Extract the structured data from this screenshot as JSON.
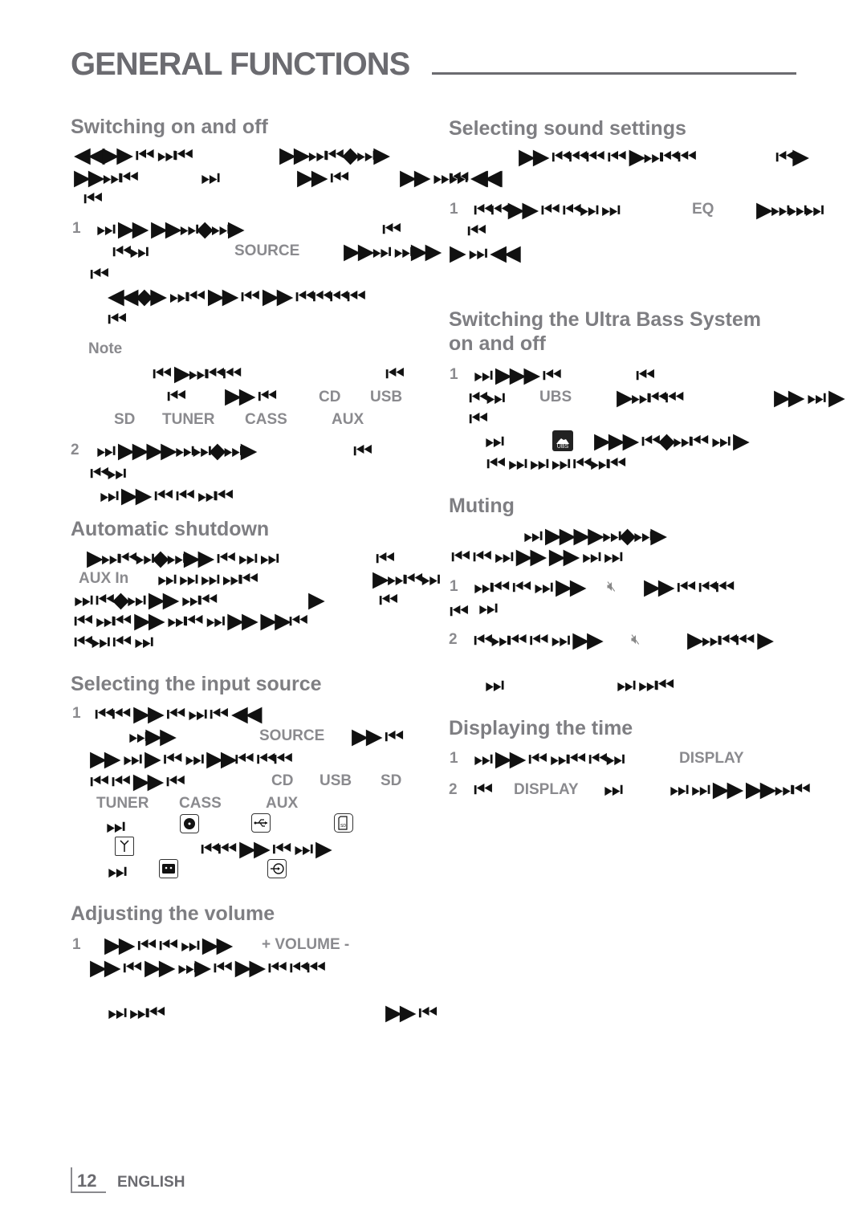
{
  "page": {
    "title": "GENERAL FUNCTIONS",
    "footer": {
      "page_number": "12",
      "language": "ENGLISH"
    }
  },
  "glyphs": {
    "a": "◀◀▶▶ ⏮ ⏭⏮",
    "b": "▶▶⏭⏮◆⏭▶",
    "c": "▶▶⏭⏮",
    "d": "⏭",
    "e": "▶▶ ⏮",
    "f": "▶▶ ⏭⏮ ◀◀",
    "g": "⏮",
    "h": "⏭ ▶▶ ▶▶⏭◆⏭▶",
    "i": "⏮⏭",
    "j": "▶▶⏭ ⏭▶▶",
    "k": "⏭ ◀◀",
    "l": "◀◀◆▶ ⏭⏮ ▶▶ ⏮ ▶▶ ⏮⏮⏮⏮",
    "m": "⏮ ▶⏭⏮⏮",
    "n": "▶▶ ⏮",
    "o": "⏭ ▶▶▶▶⏭⏭◆⏭▶",
    "p": "⏭ ▶▶ ⏮ ⏮ ⏭⏮",
    "q": "▶⏭⏮⏭◆⏭▶▶ ⏮ ⏭ ⏭",
    "r": "⏭ ⏭ ⏭ ⏭⏮",
    "s": "▶⏭⏮⏭",
    "t": "⏭ ⏮◆⏭ ▶▶ ⏭⏮",
    "u": "▶",
    "v": "⏮ ⏭⏮ ▶▶ ⏭⏮ ⏭ ▶▶ ▶▶⏮",
    "w": "⏮⏭ ⏮ ⏭",
    "x": "⏮⏮ ▶▶ ⏮ ⏭ ⏮ ◀◀",
    "y": "⏭▶▶",
    "z": "▶▶ ⏭ ▶ ⏮ ⏭ ▶▶⏮ ⏮⏮",
    "aa": "⏮ ⏮ ▶▶ ⏮",
    "ab": "⏮⏮ ▶▶ ⏮ ⏭ ▶",
    "ac": "▶▶ ⏮ ⏮ ⏭ ▶▶",
    "ad": "▶▶ ⏮ ▶▶ ⏭▶ ⏮ ▶▶ ⏮ ⏮⏮",
    "ae": "⏭ ⏭⏮",
    "af": "▶▶ ⏮⏮⏮ ⏮ ▶⏭⏮⏮",
    "ag": "⏮▶",
    "ah": "⏭ ◀◀",
    "ai": "⏮⏮▶▶ ⏮ ⏮⏭ ⏭",
    "aj": "▶⏭⏭⏭",
    "ak": "▶ ⏭ ◀◀",
    "al": "⏭ ▶▶▶ ⏮",
    "am": "⏮⏭",
    "an": "▶⏭⏮⏮",
    "ao": "▶▶ ⏭ ▶",
    "ap": "▶▶▶ ⏮◆⏭⏮ ⏭ ▶",
    "aq": "⏮ ⏭ ⏭ ⏭ ⏮⏭⏮",
    "ar": "⏭ ▶▶▶▶⏭◆⏭▶",
    "as": "⏮ ⏮ ⏭ ▶▶ ▶▶ ⏭ ⏭",
    "at": "⏭⏮ ⏮ ⏭ ▶▶",
    "au": "▶▶ ⏮ ⏮⏮",
    "av": "⏮⏭⏮ ⏮ ⏭ ▶▶",
    "aw": "▶⏭⏮⏮ ▶",
    "ax": "⏭ ⏭⏮",
    "ay": "⏭ ▶▶ ⏮ ⏭⏮ ⏮⏭",
    "az": "⏮",
    "ba": "⏭ ⏭ ▶▶ ▶▶⏭⏮"
  },
  "left_column": {
    "switching": {
      "heading": "Switching on and off",
      "step1": "1",
      "source_label": "SOURCE",
      "note_label": "Note",
      "sources": [
        "CD",
        "USB",
        "SD",
        "TUNER",
        "CASS",
        "AUX"
      ],
      "step2": "2"
    },
    "shutdown": {
      "heading": "Automatic shutdown",
      "aux_in_label": "AUX In"
    },
    "input_source": {
      "heading": "Selecting the input source",
      "step1": "1",
      "source_label": "SOURCE",
      "sources": [
        "CD",
        "USB",
        "SD",
        "TUNER",
        "CASS",
        "AUX"
      ],
      "icons": [
        "cd-icon",
        "usb-icon",
        "sd-card-icon",
        "tuner-antenna-icon",
        "cassette-icon",
        "aux-input-icon"
      ]
    },
    "volume": {
      "heading": "Adjusting the volume",
      "step1": "1",
      "volume_label": "+ VOLUME -",
      "plus": "+",
      "minus": "–"
    }
  },
  "right_column": {
    "sound": {
      "heading": "Selecting sound settings",
      "step1": "1",
      "eq_label": "EQ"
    },
    "ubs": {
      "heading_line1": "Switching the Ultra Bass System",
      "heading_line2": "on and off",
      "step1": "1",
      "ubs_label": "UBS",
      "icon_text": "UBS"
    },
    "muting": {
      "heading": "Muting",
      "step1": "1",
      "step2": "2"
    },
    "time": {
      "heading": "Displaying the time",
      "step1": "1",
      "step2": "2",
      "display_label": "DISPLAY"
    }
  }
}
